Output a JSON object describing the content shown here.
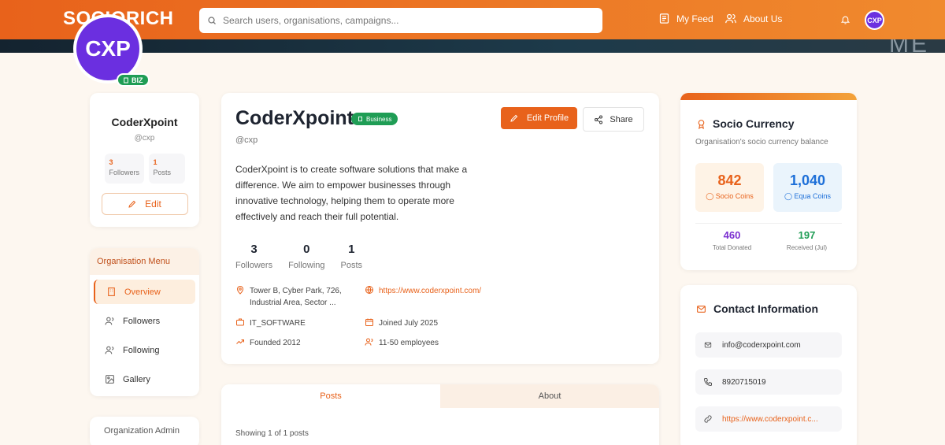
{
  "header": {
    "logo_text": "SOCIORICH",
    "search_placeholder": "Search users, organisations, campaigns...",
    "my_feed": "My Feed",
    "about_us": "About Us",
    "avatar_initials": "CXP"
  },
  "banner": {
    "ghost_text": "ME"
  },
  "profile": {
    "avatar_initials": "CXP",
    "badge": "BIZ",
    "name": "CoderXpoint",
    "handle": "@cxp",
    "followers_count": "3",
    "followers_label": "Followers",
    "posts_count": "1",
    "posts_label": "Posts",
    "edit_label": "Edit"
  },
  "menu": {
    "title": "Organisation Menu",
    "items": [
      {
        "label": "Overview"
      },
      {
        "label": "Followers"
      },
      {
        "label": "Following"
      },
      {
        "label": "Gallery"
      }
    ]
  },
  "admin": {
    "title": "Organization Admin"
  },
  "main": {
    "name": "CoderXpoint",
    "pill": "Business",
    "handle": "@cxp",
    "edit_profile": "Edit Profile",
    "share": "Share",
    "bio": "CoderXpoint is to create software solutions that make a difference. We aim to empower businesses through innovative technology, helping them to operate more effectively and reach their full potential.",
    "stats": [
      {
        "value": "3",
        "label": "Followers"
      },
      {
        "value": "0",
        "label": "Following"
      },
      {
        "value": "1",
        "label": "Posts"
      }
    ],
    "info": {
      "address": "Tower B, Cyber Park, 726, Industrial Area, Sector ...",
      "website": "https://www.coderxpoint.com/",
      "industry": "IT_SOFTWARE",
      "joined": "Joined July 2025",
      "founded": "Founded 2012",
      "employees": "11-50 employees"
    }
  },
  "tabs": {
    "posts": "Posts",
    "about": "About",
    "showing": "Showing 1 of 1 posts"
  },
  "currency": {
    "title": "Socio Currency",
    "subtitle": "Organisation's socio currency balance",
    "socio_value": "842",
    "socio_label": "Socio Coins",
    "equa_value": "1,040",
    "equa_label": "Equa Coins",
    "donated_value": "460",
    "donated_label": "Total Donated",
    "received_value": "197",
    "received_label": "Received (Jul)"
  },
  "contact": {
    "title": "Contact Information",
    "email": "info@coderxpoint.com",
    "phone": "8920715019",
    "website": "https://www.coderxpoint.c..."
  },
  "colors": {
    "accent": "#e8621b",
    "business_green": "#1f9d55",
    "equa_blue": "#1d6fd8",
    "donated_purple": "#7b2fd0",
    "received_green": "#1f9d55"
  }
}
